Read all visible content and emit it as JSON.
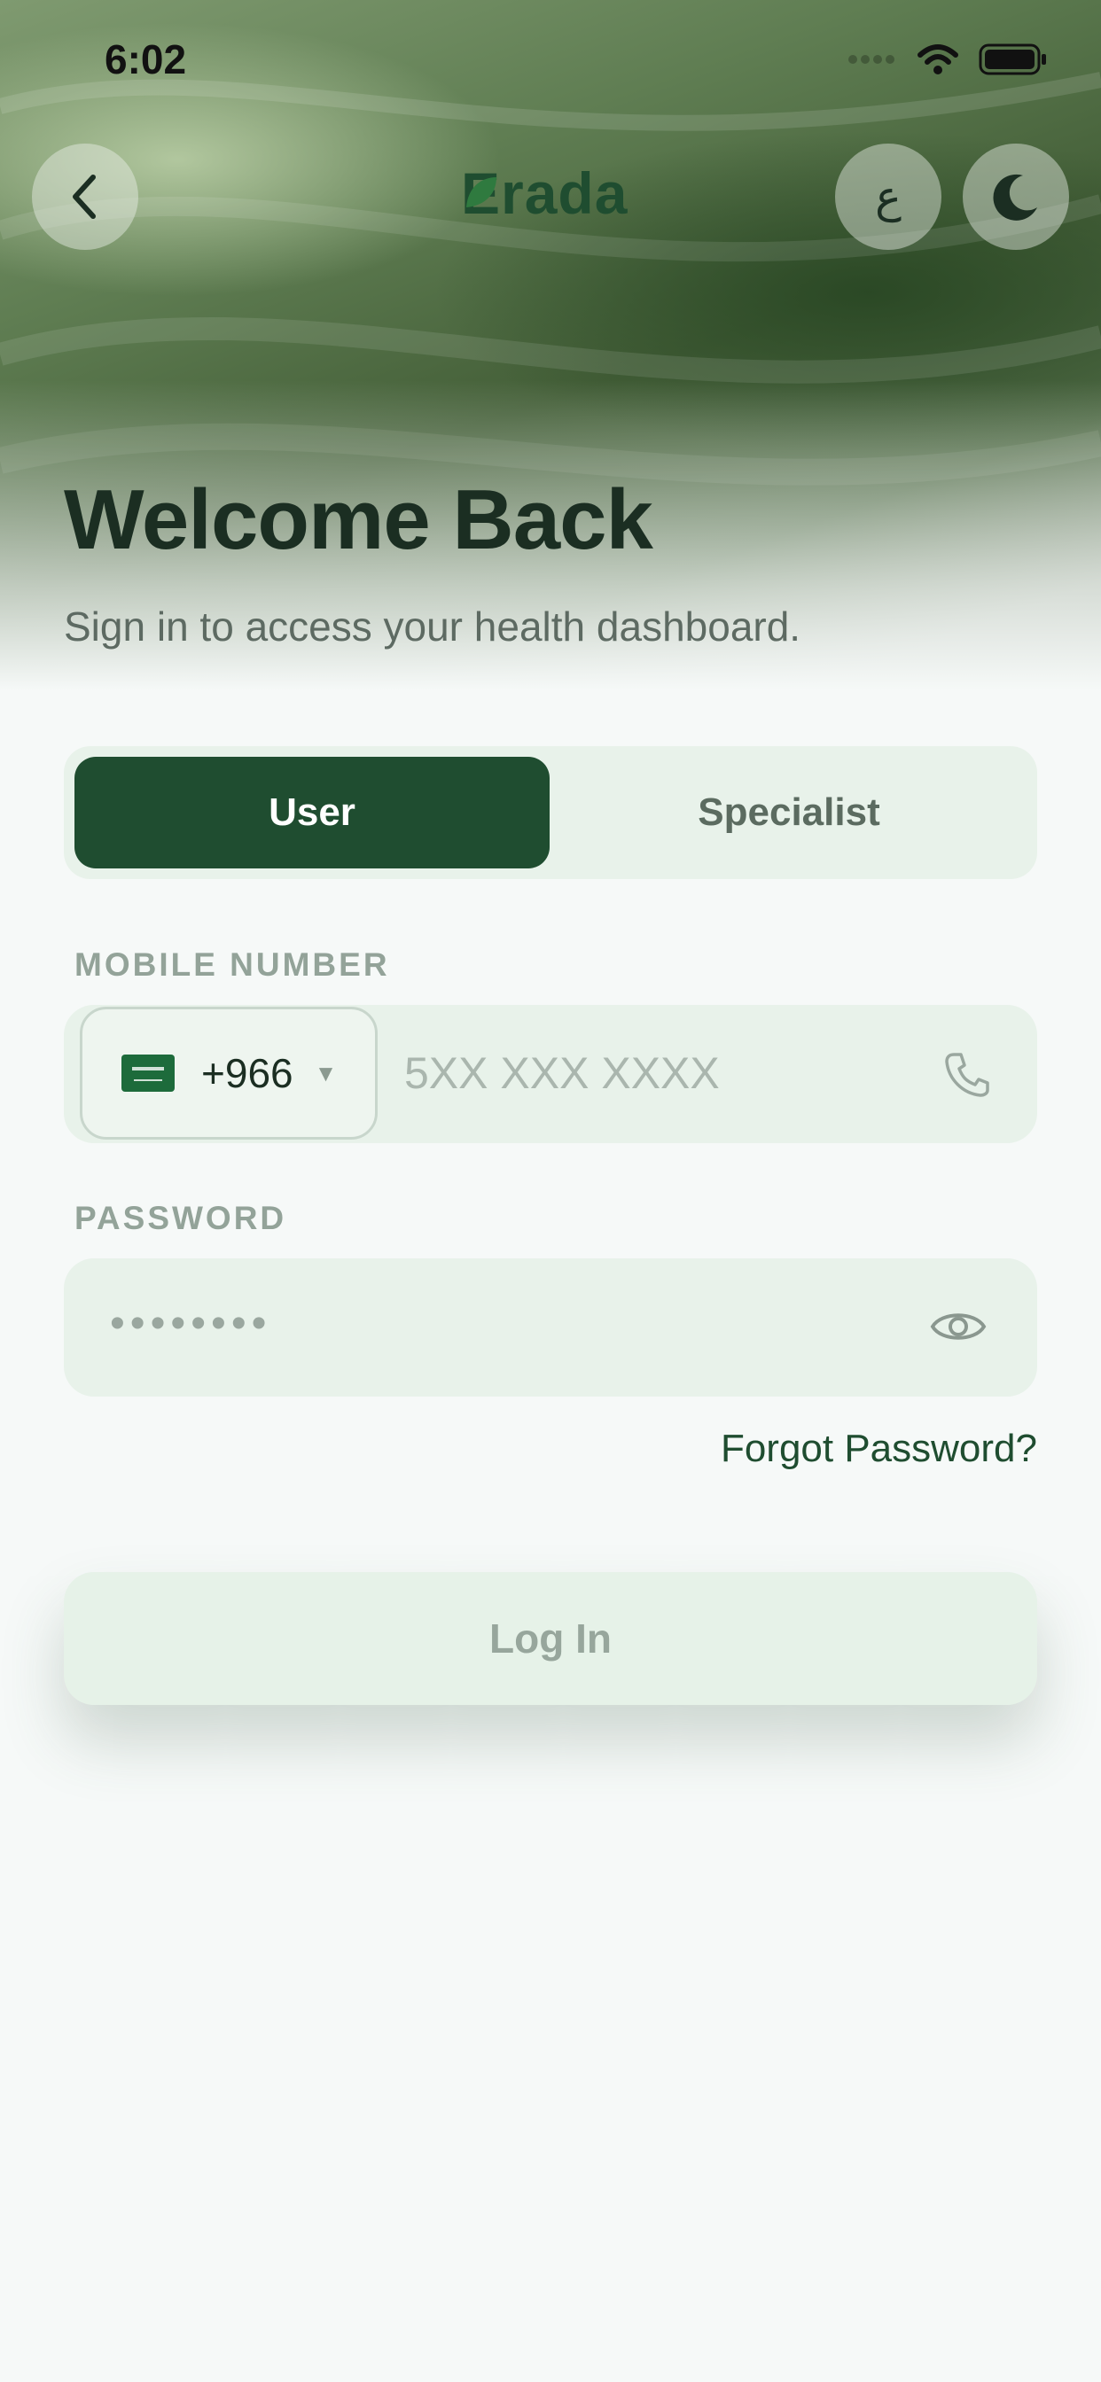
{
  "status_bar": {
    "time": "6:02"
  },
  "header": {
    "logo_text": "Erada",
    "language_toggle_label": "ع",
    "icons": [
      "chevron-left-icon",
      "moon-icon"
    ]
  },
  "welcome": {
    "title": "Welcome Back",
    "subtitle": "Sign in to access your health dashboard."
  },
  "account_type": {
    "options": [
      {
        "label": "User",
        "selected": true
      },
      {
        "label": "Specialist",
        "selected": false
      }
    ]
  },
  "mobile": {
    "label": "MOBILE NUMBER",
    "country_code": "+966",
    "placeholder": "5XX XXX XXXX"
  },
  "password": {
    "label": "PASSWORD",
    "masked_value": "••••••••"
  },
  "forgot_password": "Forgot Password?",
  "login_button": "Log In",
  "colors": {
    "brand_green": "#1f4d30",
    "field_background": "#e8f2ea",
    "page_background": "#f6f9f8"
  }
}
